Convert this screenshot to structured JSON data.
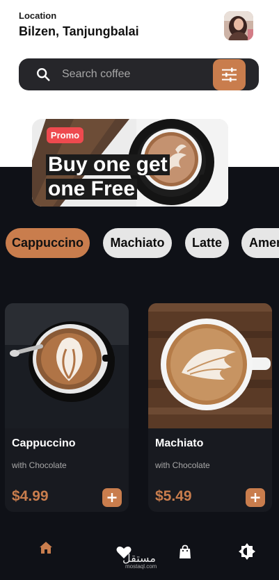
{
  "header": {
    "location_label": "Location",
    "location_value": "Bilzen, Tanjungbalai"
  },
  "search": {
    "placeholder": "Search coffee"
  },
  "promo": {
    "badge": "Promo",
    "title_line1": "Buy one get",
    "title_line2": "one Free"
  },
  "categories": [
    {
      "label": "Cappuccino",
      "active": true
    },
    {
      "label": "Machiato",
      "active": false
    },
    {
      "label": "Latte",
      "active": false
    },
    {
      "label": "Americano",
      "active": false
    }
  ],
  "products": [
    {
      "name": "Cappuccino",
      "subtitle": "with Chocolate",
      "price": "$4.99"
    },
    {
      "name": "Machiato",
      "subtitle": "with Chocolate",
      "price": "$5.49"
    }
  ],
  "watermark": {
    "text": "مستقل",
    "sub": "mostaql.com"
  },
  "colors": {
    "accent": "#c97d4d",
    "dark_bg": "#0f1117",
    "promo_badge": "#ee4a4f"
  }
}
